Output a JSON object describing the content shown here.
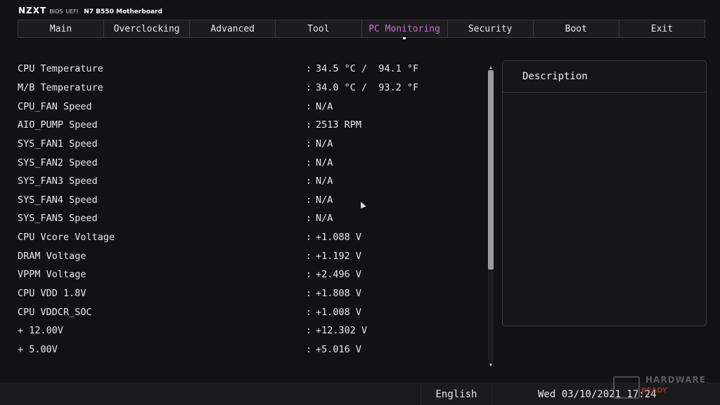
{
  "brand": {
    "logo": "NZXT",
    "bios": "BIOS",
    "uefi": "UEFI",
    "model": "N7 B550 Motherboard"
  },
  "tabs": [
    {
      "label": "Main"
    },
    {
      "label": "Overclocking"
    },
    {
      "label": "Advanced"
    },
    {
      "label": "Tool"
    },
    {
      "label": "PC Monitoring",
      "active": true
    },
    {
      "label": "Security"
    },
    {
      "label": "Boot"
    },
    {
      "label": "Exit"
    }
  ],
  "monitoring": {
    "separator": ":",
    "rows": [
      {
        "label": "CPU Temperature",
        "value": "34.5 °C /  94.1 °F"
      },
      {
        "label": "M/B Temperature",
        "value": "34.0 °C /  93.2 °F"
      },
      {
        "label": "CPU_FAN Speed",
        "value": "N/A"
      },
      {
        "label": "AIO_PUMP Speed",
        "value": "2513 RPM"
      },
      {
        "label": "SYS_FAN1 Speed",
        "value": "N/A"
      },
      {
        "label": "SYS_FAN2 Speed",
        "value": "N/A"
      },
      {
        "label": "SYS_FAN3 Speed",
        "value": "N/A"
      },
      {
        "label": "SYS_FAN4 Speed",
        "value": "N/A"
      },
      {
        "label": "SYS_FAN5 Speed",
        "value": "N/A"
      },
      {
        "label": "CPU Vcore Voltage",
        "value": "+1.088 V"
      },
      {
        "label": "DRAM Voltage",
        "value": "+1.192 V"
      },
      {
        "label": "VPPM Voltage",
        "value": "+2.496 V"
      },
      {
        "label": "CPU VDD 1.8V",
        "value": "+1.808 V"
      },
      {
        "label": "CPU VDDCR_SOC",
        "value": "+1.008 V"
      },
      {
        "label": "+ 12.00V",
        "value": "+12.302 V"
      },
      {
        "label": "+ 5.00V",
        "value": "+5.016 V"
      }
    ]
  },
  "description": {
    "title": "Description"
  },
  "footer": {
    "language": "English",
    "datetime": "Wed 03/10/2021  17:24"
  },
  "watermark": {
    "text": "HARDWARE",
    "ready": "READY"
  },
  "colors": {
    "accent": "#c86ad6",
    "background": "#121214"
  }
}
